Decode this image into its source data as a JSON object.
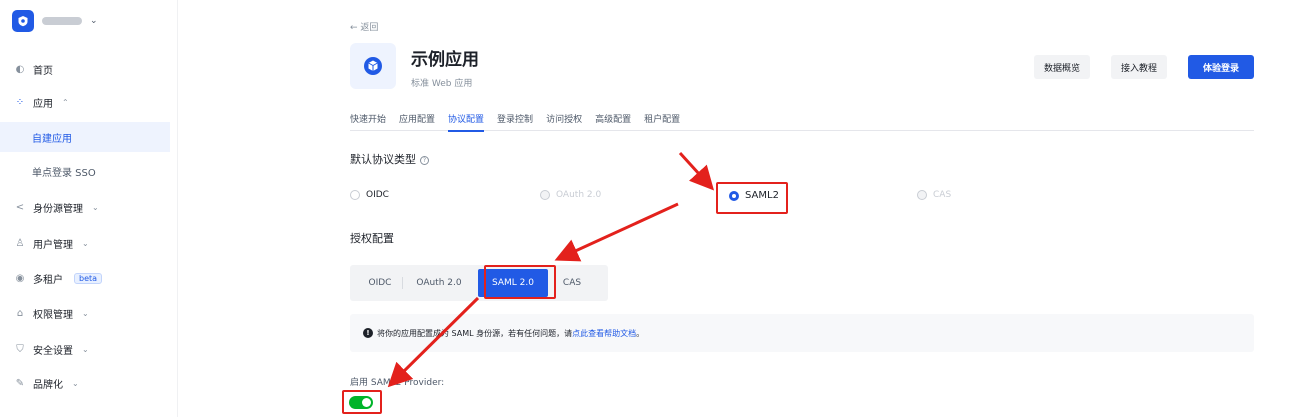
{
  "sidebar": {
    "items": [
      {
        "label": "首页",
        "icon": "home-icon"
      },
      {
        "label": "应用",
        "icon": "apps-icon",
        "expanded": true
      },
      {
        "label": "自建应用",
        "sub": true,
        "active": true
      },
      {
        "label": "单点登录 SSO",
        "sub": true
      },
      {
        "label": "身份源管理",
        "icon": "share-icon"
      },
      {
        "label": "用户管理",
        "icon": "users-icon"
      },
      {
        "label": "多租户",
        "icon": "tenant-icon",
        "badge": "beta"
      },
      {
        "label": "权限管理",
        "icon": "lock-icon"
      },
      {
        "label": "安全设置",
        "icon": "shield-icon"
      },
      {
        "label": "品牌化",
        "icon": "brush-icon"
      }
    ]
  },
  "header": {
    "back": "← 返回",
    "title": "示例应用",
    "subtitle": "标准 Web 应用",
    "buttons": {
      "overview": "数据概览",
      "tutorial": "接入教程",
      "login": "体验登录"
    }
  },
  "tabs": [
    "快速开始",
    "应用配置",
    "协议配置",
    "登录控制",
    "访问授权",
    "高级配置",
    "租户配置"
  ],
  "active_tab": "协议配置",
  "protocol": {
    "title": "默认协议类型",
    "options": [
      {
        "label": "OIDC",
        "state": "normal"
      },
      {
        "label": "OAuth 2.0",
        "state": "disabled"
      },
      {
        "label": "SAML2",
        "state": "checked"
      },
      {
        "label": "CAS",
        "state": "disabled"
      }
    ]
  },
  "auth": {
    "title": "授权配置",
    "segments": [
      "OIDC",
      "OAuth 2.0",
      "SAML 2.0",
      "CAS"
    ],
    "active": "SAML 2.0"
  },
  "banner": {
    "text": "将你的应用配置成为 SAML 身份源，若有任何问题，请 ",
    "link": "点此查看帮助文档",
    "end": "。"
  },
  "provider": {
    "label": "启用 SAML2 Provider:",
    "enabled": true
  },
  "colors": {
    "primary": "#215ae5",
    "toggle_on": "#00b42a",
    "annotation": "#e3211c"
  }
}
